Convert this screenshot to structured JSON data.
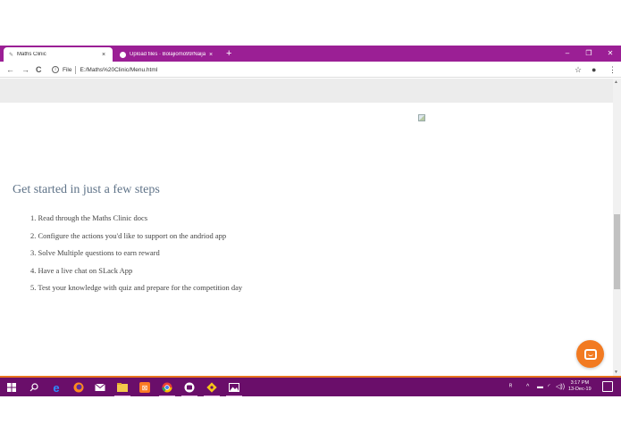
{
  "browser": {
    "tabs": [
      {
        "title": "Maths Clinic",
        "close": "×"
      },
      {
        "title": "Upload files · Bolajiomo99/Naija",
        "close": "×"
      }
    ],
    "new_tab": "+",
    "window_controls": {
      "minimize": "–",
      "restore": "❐",
      "close": "✕"
    },
    "nav": {
      "back": "←",
      "forward": "→",
      "reload": "C"
    },
    "address": {
      "info": "i",
      "scheme_label": "File",
      "url": "E:/Maths%20Clinic/Menu.html"
    },
    "toolbar_right": {
      "bookmark": "☆",
      "profile": "●",
      "menu": "⋮"
    }
  },
  "page": {
    "heading": "Get started in just a few steps",
    "steps": [
      "1. Read through the Maths Clinic docs",
      "2. Configure the actions you'd like to support on the andriod app",
      "3. Solve Multiple questions to earn reward",
      "4. Have a live chat on SLack App",
      "5. Test your knowledge with quiz and prepare for the competition day"
    ]
  },
  "taskbar": {
    "clock_time": "3:17 PM",
    "clock_date": "13-Dec-19",
    "tray": {
      "people": "ᴿ",
      "chevron": "^",
      "battery": "▬",
      "wifi": "◜",
      "volume": "◁))"
    }
  },
  "colors": {
    "tab_strip": "#9b1f95",
    "taskbar": "#6a0e6a",
    "taskbar_accent": "#e8731f",
    "chat_button": "#f27a21",
    "heading": "#5f7388"
  }
}
